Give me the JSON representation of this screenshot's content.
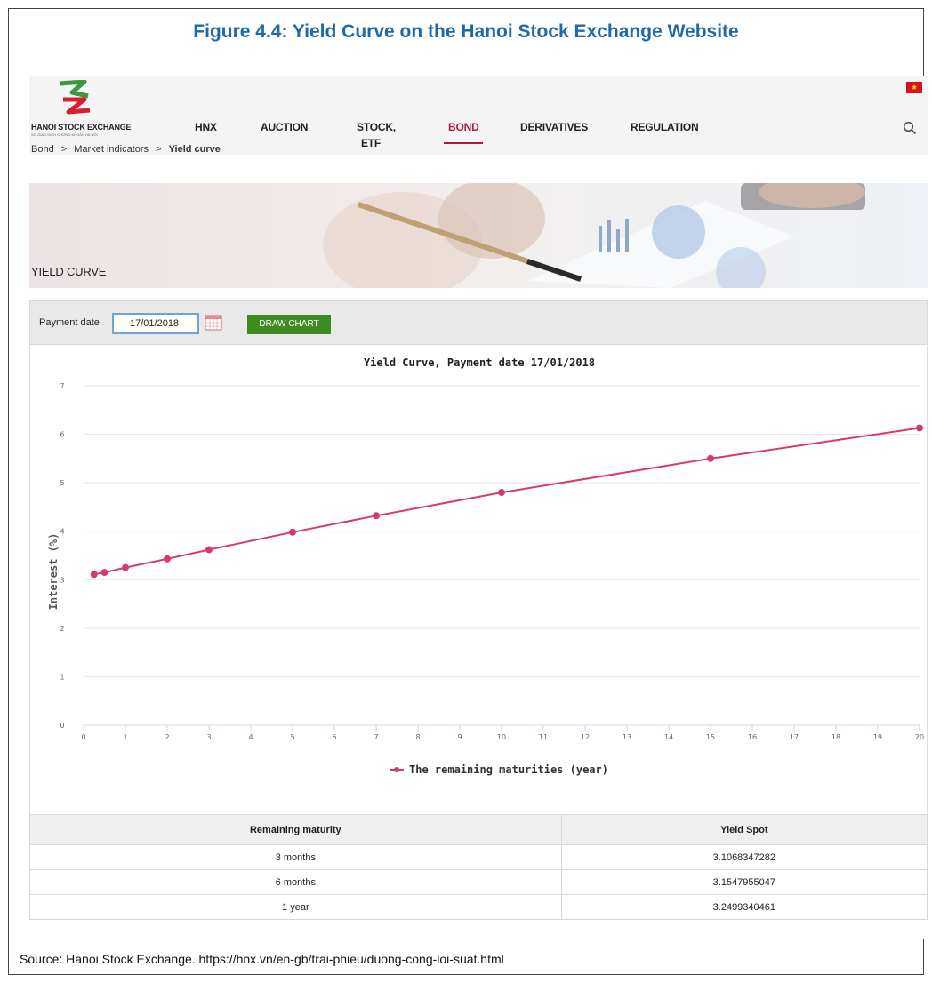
{
  "figure": {
    "title": "Figure 4.4: Yield Curve on the Hanoi Stock Exchange Website",
    "source": "Source: Hanoi Stock Exchange. https://hnx.vn/en-gb/trai-phieu/duong-cong-loi-suat.html"
  },
  "header": {
    "logo_text": "HANOI STOCK EXCHANGE",
    "logo_sub": "SỞ GIAO DỊCH CHỨNG KHOÁN HÀ NỘI",
    "nav": [
      {
        "label": "HNX"
      },
      {
        "label": "AUCTION"
      },
      {
        "label": "STOCK,"
      },
      {
        "label": "ETF"
      },
      {
        "label": "BOND"
      },
      {
        "label": "DERIVATIVES"
      },
      {
        "label": "REGULATION"
      }
    ],
    "flag_icon": "vietnam-flag-icon",
    "search_icon": "search-icon",
    "active_color": "#b0193f"
  },
  "breadcrumb": {
    "items": [
      "Bond",
      ">",
      "Market indicators",
      ">",
      "Yield curve"
    ]
  },
  "banner": {
    "title": "YIELD CURVE"
  },
  "form": {
    "label": "Payment date",
    "date_value": "17/01/2018",
    "button_label": "DRAW CHART",
    "button_color": "#3e8b22"
  },
  "chart_data": {
    "type": "line",
    "title": "Yield Curve, Payment date 17/01/2018",
    "xlabel": "",
    "ylabel": "Interest (%)",
    "xlim": [
      0,
      20
    ],
    "ylim": [
      0,
      7
    ],
    "x_ticks": [
      0,
      1,
      2,
      3,
      4,
      5,
      6,
      7,
      8,
      9,
      10,
      11,
      12,
      13,
      14,
      15,
      16,
      17,
      18,
      19,
      20
    ],
    "y_ticks": [
      0,
      1,
      2,
      3,
      4,
      5,
      6,
      7
    ],
    "grid": true,
    "legend_position": "bottom",
    "series": [
      {
        "name": "The remaining maturities (year)",
        "color": "#d63a6b",
        "points": [
          {
            "x": 0.25,
            "y": 3.11
          },
          {
            "x": 0.5,
            "y": 3.15
          },
          {
            "x": 1,
            "y": 3.25
          },
          {
            "x": 2,
            "y": 3.43
          },
          {
            "x": 3,
            "y": 3.62
          },
          {
            "x": 5,
            "y": 3.98
          },
          {
            "x": 7,
            "y": 4.32
          },
          {
            "x": 10,
            "y": 4.8
          },
          {
            "x": 15,
            "y": 5.5
          },
          {
            "x": 20,
            "y": 6.13
          }
        ]
      }
    ]
  },
  "table": {
    "headers": [
      "Remaining maturity",
      "Yield Spot"
    ],
    "rows": [
      [
        "3 months",
        "3.1068347282"
      ],
      [
        "6 months",
        "3.1547955047"
      ],
      [
        "1 year",
        "3.2499340461"
      ]
    ]
  }
}
